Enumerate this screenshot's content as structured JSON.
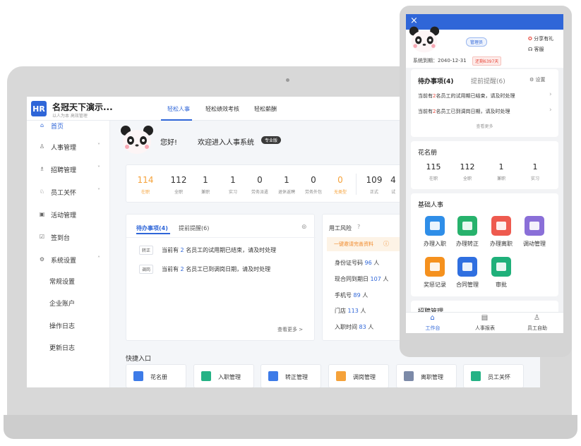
{
  "desktop": {
    "brand": {
      "logo": "HR",
      "name": "名冠天下演示...",
      "sub": "以人为本 高效管理"
    },
    "tabs": [
      {
        "label": "轻松人事",
        "active": true
      },
      {
        "label": "轻松绩效考核",
        "active": false
      },
      {
        "label": "轻松薪酬",
        "active": false
      }
    ],
    "sidebar": [
      {
        "icon": "home-icon",
        "label": "首页",
        "active": true
      },
      {
        "icon": "user-icon",
        "label": "人事管理",
        "chevron": "˅"
      },
      {
        "icon": "recruit-icon",
        "label": "招聘管理",
        "chevron": "˅"
      },
      {
        "icon": "relation-icon",
        "label": "员工关怀",
        "chevron": "˅"
      },
      {
        "icon": "activity-icon",
        "label": "活动管理"
      },
      {
        "icon": "sign-icon",
        "label": "签到台"
      },
      {
        "icon": "gear-icon",
        "label": "系统设置",
        "chevron": "˄"
      }
    ],
    "sidebar_sub": [
      "常规设置",
      "企业账户",
      "操作日志",
      "更新日志"
    ],
    "welcome": {
      "hello": "您好!",
      "message": "欢迎进入人事系统",
      "badge": "专业版"
    },
    "stats": [
      {
        "value": "114",
        "label": "在职",
        "highlight": true
      },
      {
        "value": "112",
        "label": "全职"
      },
      {
        "value": "1",
        "label": "兼职"
      },
      {
        "value": "1",
        "label": "实习"
      },
      {
        "value": "0",
        "label": "劳务派遣"
      },
      {
        "value": "1",
        "label": "退休返聘"
      },
      {
        "value": "0",
        "label": "劳务外包"
      },
      {
        "value": "0",
        "label": "无类型",
        "highlight": true
      },
      {
        "value": "109",
        "label": "正式"
      },
      {
        "value": "4",
        "label": "试"
      }
    ],
    "todo": {
      "tab_active": "待办事项(4)",
      "tab_other": "提前提醒(6)",
      "items": [
        {
          "tag": "转正",
          "pre": "当前有",
          "count": "2",
          "post": "名员工的试用期已结束，请及时处理"
        },
        {
          "tag": "调岗",
          "pre": "当前有",
          "count": "2",
          "post": "名员工已到调岗日期，请及时处理"
        }
      ],
      "more": "查看更多 >"
    },
    "risk": {
      "title": "用工风险",
      "banner": "一键邀请完善资料",
      "items": [
        {
          "label": "身份证号码",
          "count": "96",
          "unit": "人"
        },
        {
          "label": "现合同到期日",
          "count": "107",
          "unit": "人"
        },
        {
          "label": "手机号",
          "count": "89",
          "unit": "人"
        },
        {
          "label": "门店",
          "count": "113",
          "unit": "人"
        },
        {
          "label": "入职时间",
          "count": "83",
          "unit": "人"
        }
      ]
    },
    "quick": {
      "title": "快捷入口",
      "items": [
        {
          "label": "花名册",
          "color": "#3d7be8"
        },
        {
          "label": "入职管理",
          "color": "#25b285"
        },
        {
          "label": "转正管理",
          "color": "#3d7be8"
        },
        {
          "label": "调岗管理",
          "color": "#f5a23a"
        },
        {
          "label": "离职管理",
          "color": "#7c8aa8"
        },
        {
          "label": "员工关怀",
          "color": "#25b285"
        }
      ]
    }
  },
  "mobile": {
    "close": "×",
    "role": "管理员",
    "gift": "分享有礼",
    "service": "客服",
    "expiry": {
      "label": "系统到期：2040-12-31",
      "badge": "还剩6397天"
    },
    "todo": {
      "tab_active": "待办事项(4)",
      "tab_other": "提前提醒(6)",
      "settings": "设置",
      "items": [
        {
          "pre": "当前有",
          "count": "2",
          "post": "名员工的试用期已结束，请及时处理"
        },
        {
          "pre": "当前有",
          "count": "2",
          "post": "名员工已到调岗日期，请及时处理"
        }
      ],
      "more": "查看更多"
    },
    "roster": {
      "title": "花名册",
      "stats": [
        {
          "value": "115",
          "label": "在职"
        },
        {
          "value": "112",
          "label": "全职"
        },
        {
          "value": "1",
          "label": "兼职"
        },
        {
          "value": "1",
          "label": "实习"
        }
      ]
    },
    "basic": {
      "title": "基础人事",
      "apps": [
        {
          "label": "办理入职",
          "color": "#2f8ee8"
        },
        {
          "label": "办理转正",
          "color": "#27b26c"
        },
        {
          "label": "办理离职",
          "color": "#ee5a4f"
        },
        {
          "label": "调动管理",
          "color": "#8a6fd8"
        },
        {
          "label": "奖惩记录",
          "color": "#f5911e"
        },
        {
          "label": "合同管理",
          "color": "#2f6fe0"
        },
        {
          "label": "审批",
          "color": "#1fb07a"
        }
      ]
    },
    "recruit_title": "招聘管理",
    "bottom_tabs": [
      {
        "icon": "home-icon",
        "label": "工作台",
        "active": true
      },
      {
        "icon": "report-icon",
        "label": "人事报表"
      },
      {
        "icon": "user-icon",
        "label": "员工自助"
      }
    ]
  }
}
